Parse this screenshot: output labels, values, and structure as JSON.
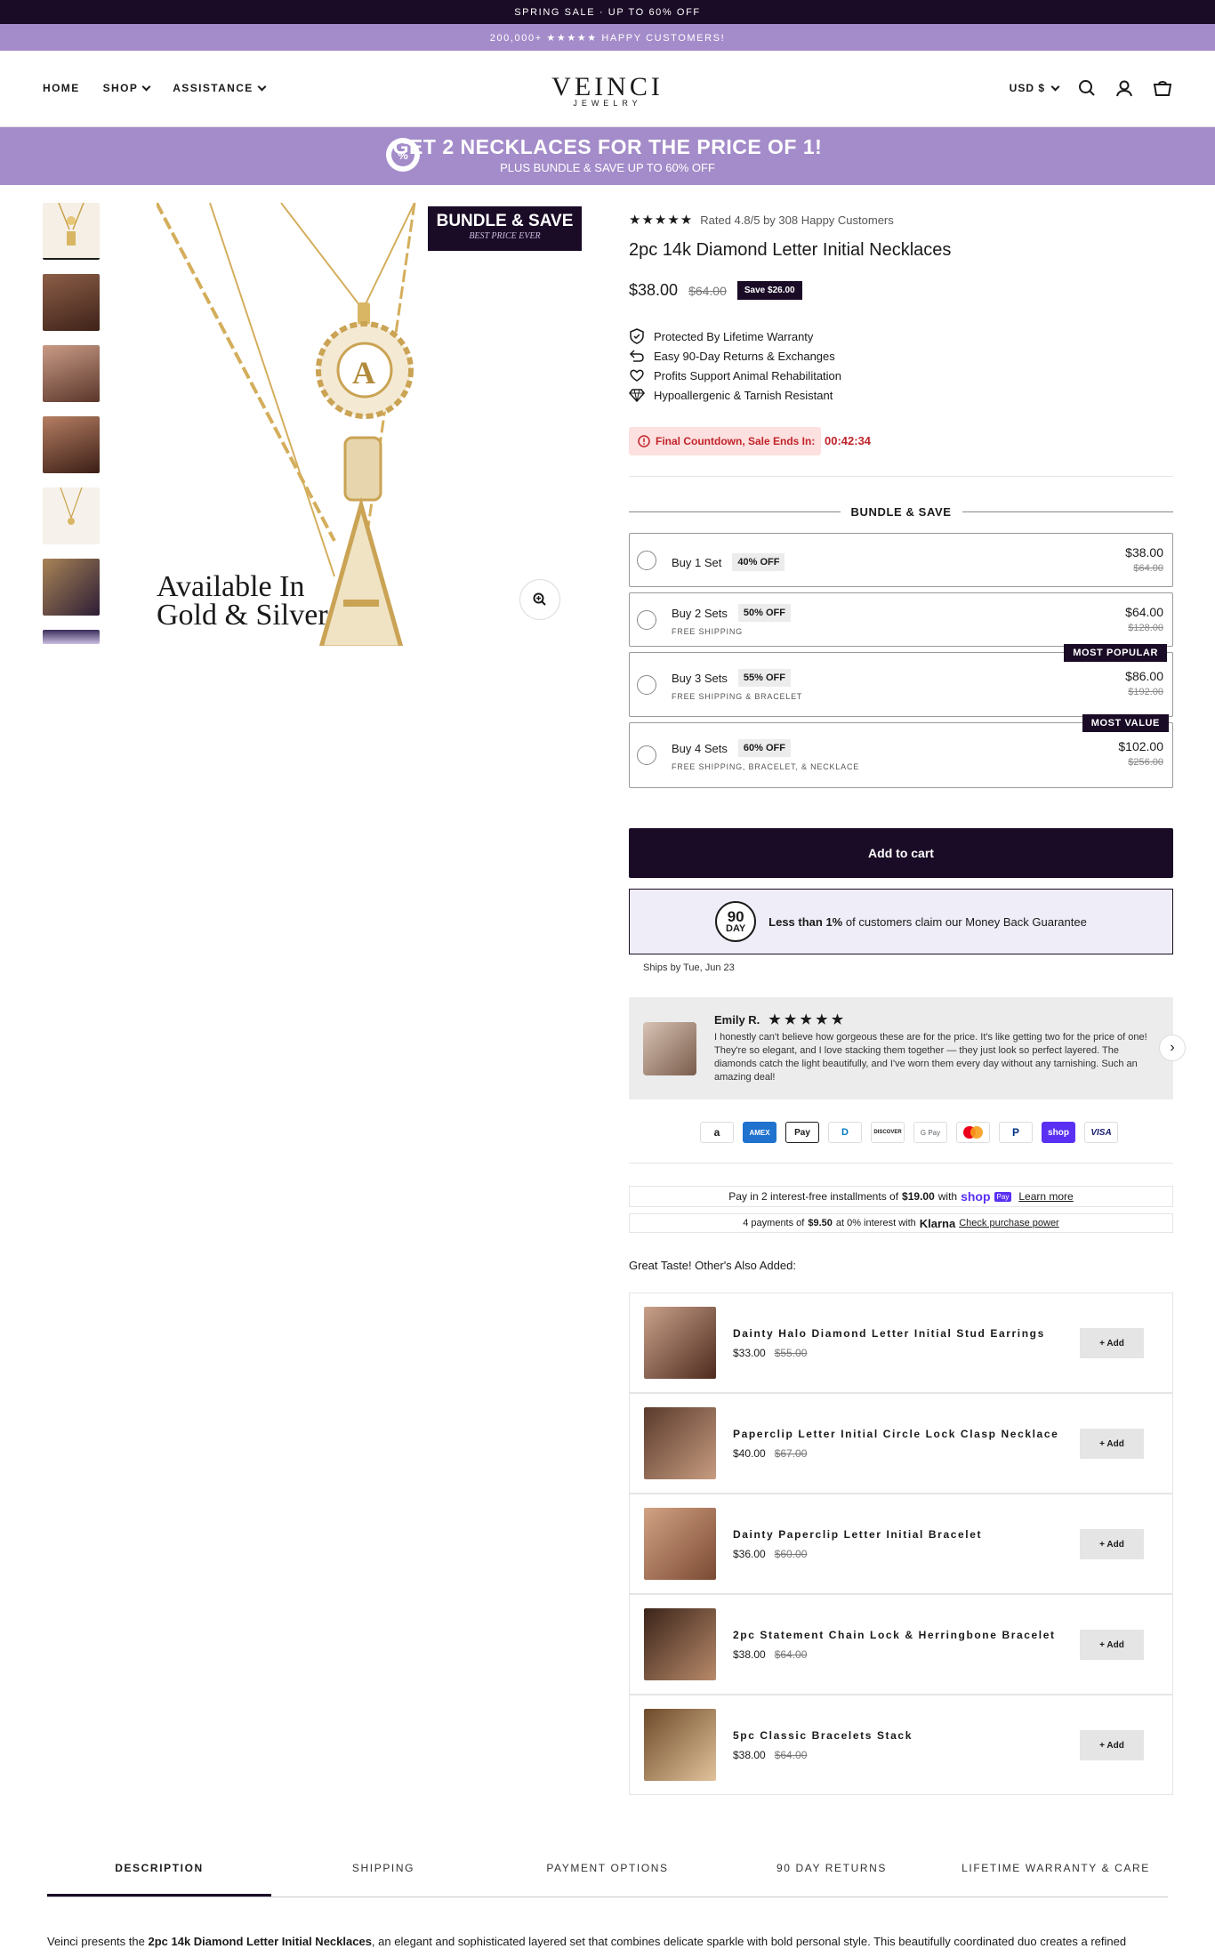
{
  "announcement": {
    "top": "SPRING SALE · UP TO 60% OFF",
    "second": "200,000+ ★★★★★ HAPPY CUSTOMERS!"
  },
  "nav": {
    "home": "HOME",
    "shop": "SHOP",
    "assistance": "ASSISTANCE",
    "logo": "VEINCI",
    "logo_sub": "JEWELRY",
    "currency": "USD $"
  },
  "promo": {
    "headline": "GET 2 NECKLACES FOR THE PRICE OF 1!",
    "sub": "PLUS BUNDLE & SAVE UP TO 60% OFF",
    "badge": "%"
  },
  "gallery": {
    "badge_title": "BUNDLE & SAVE",
    "badge_sub": "BEST PRICE EVER",
    "caption1": "Available In",
    "caption2": "Gold & Silver",
    "letter": "A"
  },
  "product": {
    "stars": "★★★★★",
    "rating": "Rated 4.8/5 by 308 Happy Customers",
    "title": "2pc 14k Diamond Letter Initial Necklaces",
    "price": "$38.00",
    "compare": "$64.00",
    "save": "Save $26.00",
    "features": [
      "Protected By Lifetime Warranty",
      "Easy 90-Day Returns & Exchanges",
      "Profits Support Animal Rehabilitation",
      "Hypoallergenic & Tarnish Resistant"
    ],
    "countdown_label": "Final Countdown, Sale Ends In:",
    "countdown": "00:42:34"
  },
  "bundle": {
    "heading": "BUNDLE & SAVE",
    "options": [
      {
        "name": "Buy 1 Set",
        "off": "40% OFF",
        "sub": "",
        "price": "$38.00",
        "compare": "$64.00",
        "tag": ""
      },
      {
        "name": "Buy 2 Sets",
        "off": "50% OFF",
        "sub": "FREE SHIPPING",
        "price": "$64.00",
        "compare": "$128.00",
        "tag": ""
      },
      {
        "name": "Buy 3 Sets",
        "off": "55% OFF",
        "sub": "FREE SHIPPING & BRACELET",
        "price": "$86.00",
        "compare": "$192.00",
        "tag": "MOST POPULAR"
      },
      {
        "name": "Buy 4 Sets",
        "off": "60% OFF",
        "sub": "FREE SHIPPING, BRACELET, & NECKLACE",
        "price": "$102.00",
        "compare": "$256.00",
        "tag": "MOST VALUE"
      }
    ]
  },
  "cart": {
    "label": "Add to cart"
  },
  "guarantee": {
    "seal_top": "90",
    "seal_bottom": "DAY",
    "bold": "Less than 1%",
    "text": "of customers claim our Money Back Guarantee"
  },
  "ships": "Ships by Tue, Jun 23",
  "review": {
    "name": "Emily R.",
    "stars": "★ ★ ★ ★ ★",
    "text": "I honestly can't believe how gorgeous these are for the price. It's like getting two for the price of one! They're so elegant, and I love stacking them together — they just look so perfect layered. The diamonds catch the light beautifully, and I've worn them every day without any tarnishing. Such an amazing deal!"
  },
  "payments": [
    "a",
    "AMEX",
    "Pay",
    "D",
    "DISCOVER",
    "G Pay",
    "MC",
    "P",
    "shop",
    "VISA"
  ],
  "installments": {
    "shop_pre": "Pay in 2 interest-free installments of",
    "shop_amt": "$19.00",
    "shop_with": "with",
    "shop_brand": "shop",
    "shop_pay": "Pay",
    "shop_link": "Learn more",
    "klarna_pre": "4 payments of",
    "klarna_amt": "$9.50",
    "klarna_mid": "at 0% interest with",
    "klarna_brand": "Klarna",
    "klarna_link": "Check purchase power"
  },
  "also_heading": "Great Taste! Other's Also Added:",
  "upsells": [
    {
      "name": "Dainty Halo Diamond Letter Initial Stud Earrings",
      "price": "$33.00",
      "compare": "$55.00",
      "add": "+ Add"
    },
    {
      "name": "Paperclip Letter Initial Circle Lock Clasp Necklace",
      "price": "$40.00",
      "compare": "$67.00",
      "add": "+ Add"
    },
    {
      "name": "Dainty Paperclip Letter Initial Bracelet",
      "price": "$36.00",
      "compare": "$60.00",
      "add": "+ Add"
    },
    {
      "name": "2pc Statement Chain Lock & Herringbone Bracelet",
      "price": "$38.00",
      "compare": "$64.00",
      "add": "+ Add"
    },
    {
      "name": "5pc Classic Bracelets Stack",
      "price": "$38.00",
      "compare": "$64.00",
      "add": "+ Add"
    }
  ],
  "tabs": [
    "DESCRIPTION",
    "SHIPPING",
    "PAYMENT OPTIONS",
    "90 DAY RETURNS",
    "LIFETIME WARRANTY & CARE"
  ],
  "description": {
    "pre": "Veinci presents the",
    "bold": "2pc 14k Diamond Letter Initial Necklaces",
    "post": ", an elegant and sophisticated layered set that combines delicate sparkle with bold personal style. This beautifully coordinated duo creates a refined"
  },
  "colors": {
    "dark": "#1a0b26",
    "lavender": "#a48cca",
    "alert": "#c0242a"
  }
}
